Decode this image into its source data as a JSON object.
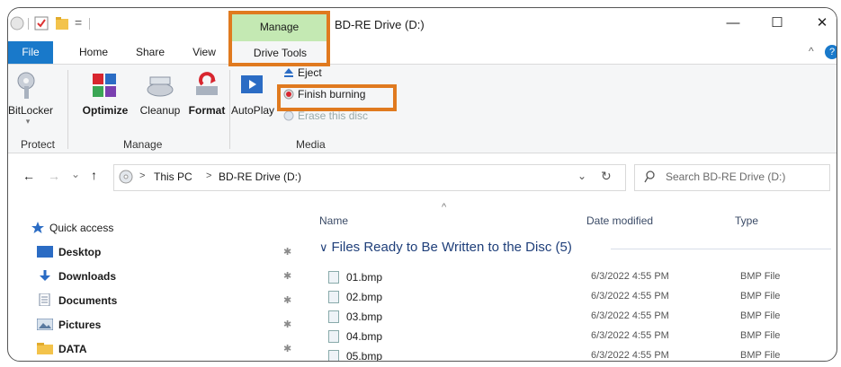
{
  "window": {
    "title": "BD-RE Drive (D:)",
    "minimize_glyph": "—",
    "maximize_glyph": "☐",
    "close_glyph": "✕",
    "help_glyph": "?",
    "collapse_glyph": "^"
  },
  "qat": {
    "dropdown_glyph": "="
  },
  "tabs": {
    "file": "File",
    "home": "Home",
    "share": "Share",
    "view": "View",
    "manage_context": "Manage",
    "drive_tools": "Drive Tools"
  },
  "ribbon": {
    "protect": {
      "bitlocker": "BitLocker",
      "group": "Protect"
    },
    "manage": {
      "optimize": "Optimize",
      "cleanup": "Cleanup",
      "format": "Format",
      "group": "Manage"
    },
    "media": {
      "autoplay": "AutoPlay",
      "eject": "Eject",
      "finish_burning": "Finish burning",
      "erase": "Erase this disc",
      "group": "Media"
    }
  },
  "nav": {
    "back": "←",
    "forward": "→",
    "recent": "⌄",
    "up": "↑",
    "breadcrumb_sep": ">",
    "breadcrumb": [
      "This PC",
      "BD-RE Drive (D:)"
    ],
    "addr_dropdown": "⌄",
    "refresh": "↻",
    "search_placeholder": "Search BD-RE Drive (D:)"
  },
  "sidebar": {
    "quick_access": "Quick access",
    "pin_glyph": "✱",
    "items": [
      {
        "label": "Desktop",
        "icon": "desktop-icon",
        "color": "#2b6cc4"
      },
      {
        "label": "Downloads",
        "icon": "download-icon",
        "color": "#2b6cc4"
      },
      {
        "label": "Documents",
        "icon": "documents-icon",
        "color": "#7a8aa0"
      },
      {
        "label": "Pictures",
        "icon": "pictures-icon",
        "color": "#5a7aa0"
      },
      {
        "label": "DATA",
        "icon": "folder-icon",
        "color": "#f3c34b"
      }
    ]
  },
  "content": {
    "sort_indicator": "^",
    "columns": {
      "name": "Name",
      "date": "Date modified",
      "type": "Type"
    },
    "group_chevron": "∨",
    "group_title": "Files Ready to Be Written to the Disc (5)",
    "files": [
      {
        "name": "01.bmp",
        "date": "6/3/2022 4:55 PM",
        "type": "BMP File"
      },
      {
        "name": "02.bmp",
        "date": "6/3/2022 4:55 PM",
        "type": "BMP File"
      },
      {
        "name": "03.bmp",
        "date": "6/3/2022 4:55 PM",
        "type": "BMP File"
      },
      {
        "name": "04.bmp",
        "date": "6/3/2022 4:55 PM",
        "type": "BMP File"
      },
      {
        "name": "05.bmp",
        "date": "6/3/2022 4:55 PM",
        "type": "BMP File"
      }
    ]
  },
  "colors": {
    "file_tab": "#1979ca",
    "manage_context": "#c4e9b3",
    "highlight_box": "#e07a1f",
    "accent_blue": "#1f3f7a"
  }
}
